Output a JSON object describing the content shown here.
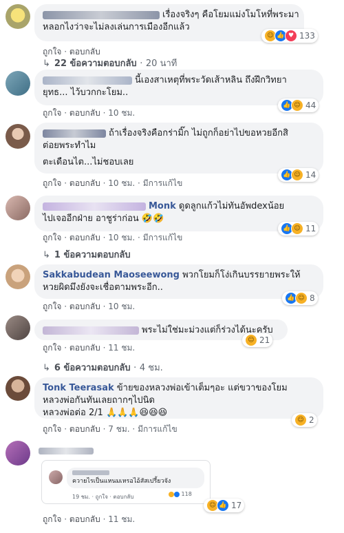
{
  "actions": {
    "like": "ถูกใจ",
    "reply": "ตอบกลับ",
    "sep": "·",
    "edited": "มีการแก้ไข"
  },
  "comments": [
    {
      "name": "",
      "text1": "เรื่องจริงๆ คือโยมแม่งโมโหที่พระมา",
      "text2": "หลอกไงว่าจะไม่ลงเล่นการเมืองอีกแล้ว",
      "time": "",
      "count": "133",
      "replies": "22 ข้อความตอบกลับ",
      "reply_time": "20 นาที"
    },
    {
      "name": "",
      "text1": "นี้เองสาเหตุที่พระวัดเส้าหลิน ถึงฝึกวิทยา",
      "text2": "ยุทธ... ไว้บวกกะโยม..",
      "time": "10 ชม.",
      "count": "44"
    },
    {
      "name": "",
      "text1": "ถ้าเรื่องจริงคือกร่ามิ๊ก ไม่ถูกก็อย่าไปขอหวยอีกสิ",
      "text2": "ต่อยพระทำไม",
      "text3": "ตะเดือนไต...ไม่ชอบเลย",
      "time": "10 ชม.",
      "count": "14"
    },
    {
      "name": "Monk",
      "text1": "ดูดลูกแก้วไม่ทันอัพdexน้อย",
      "text2": "ไปเจออีกฝ่าย อาชูร่าก่อน 🤣🤣",
      "time": "10 ชม.",
      "count": "11",
      "replies": "1 ข้อความตอบกลับ"
    },
    {
      "name": "Sakkabudean Maoseewong",
      "text1": "พวกโยมก็โง่เกินบรรยายพระให้",
      "text2": "หวยผิดมึงยังจะเชื่อตามพระอีก..",
      "time": "10 ชม.",
      "count": "8"
    },
    {
      "name": "",
      "text1": "พระไม่ใช่มะม่วงแต่ก็ร่วงได้นะครับ",
      "time": "11 ชม.",
      "count": "21",
      "replies": "6 ข้อความตอบกลับ",
      "reply_time": "4 ชม."
    },
    {
      "name": "Tonk Teerasak",
      "text1": "ข้ายของหลวงพ่อเข้าเต็มๆอะ แต่ขวาของโยม",
      "text2": "หลวงพ่อกันทันเลยถากๆไปนิด",
      "text3": "หลวงพ่อต่อ 2/1 🙏🙏🙏😆😆😆",
      "time": "7 ชม.",
      "count": "2"
    },
    {
      "name": "",
      "text1": "",
      "inner_text": "ควายไรเป็นแหนมเหรอไอ้สัสเปรี้ยวจัง",
      "inner_meta": "19 ชม. · ถูกใจ · ตอบกลับ",
      "inner_count": "118",
      "time": "11 ชม.",
      "count": "17"
    }
  ]
}
